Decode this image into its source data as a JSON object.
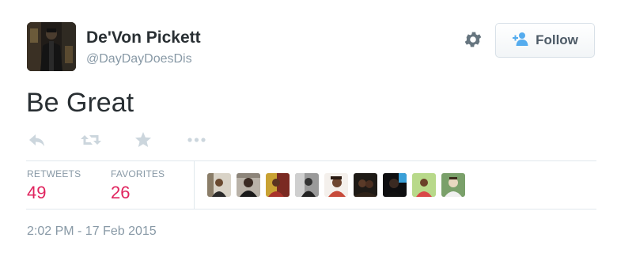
{
  "tweet": {
    "author_name": "De'Von Pickett",
    "author_handle": "@DayDayDoesDis",
    "text": "Be Great",
    "timestamp": "2:02 PM - 17 Feb 2015"
  },
  "header": {
    "follow_label": "Follow"
  },
  "stats": {
    "retweets_label": "RETWEETS",
    "retweets_count": "49",
    "favorites_label": "FAVORITES",
    "favorites_count": "26"
  },
  "actions": [
    "reply-icon",
    "retweet-icon",
    "favorite-icon",
    "more-icon"
  ],
  "colors": {
    "count_accent": "#e0245e",
    "muted_text": "#8899a6",
    "follow_icon": "#55acee",
    "action_icon": "#ccd6dd"
  }
}
